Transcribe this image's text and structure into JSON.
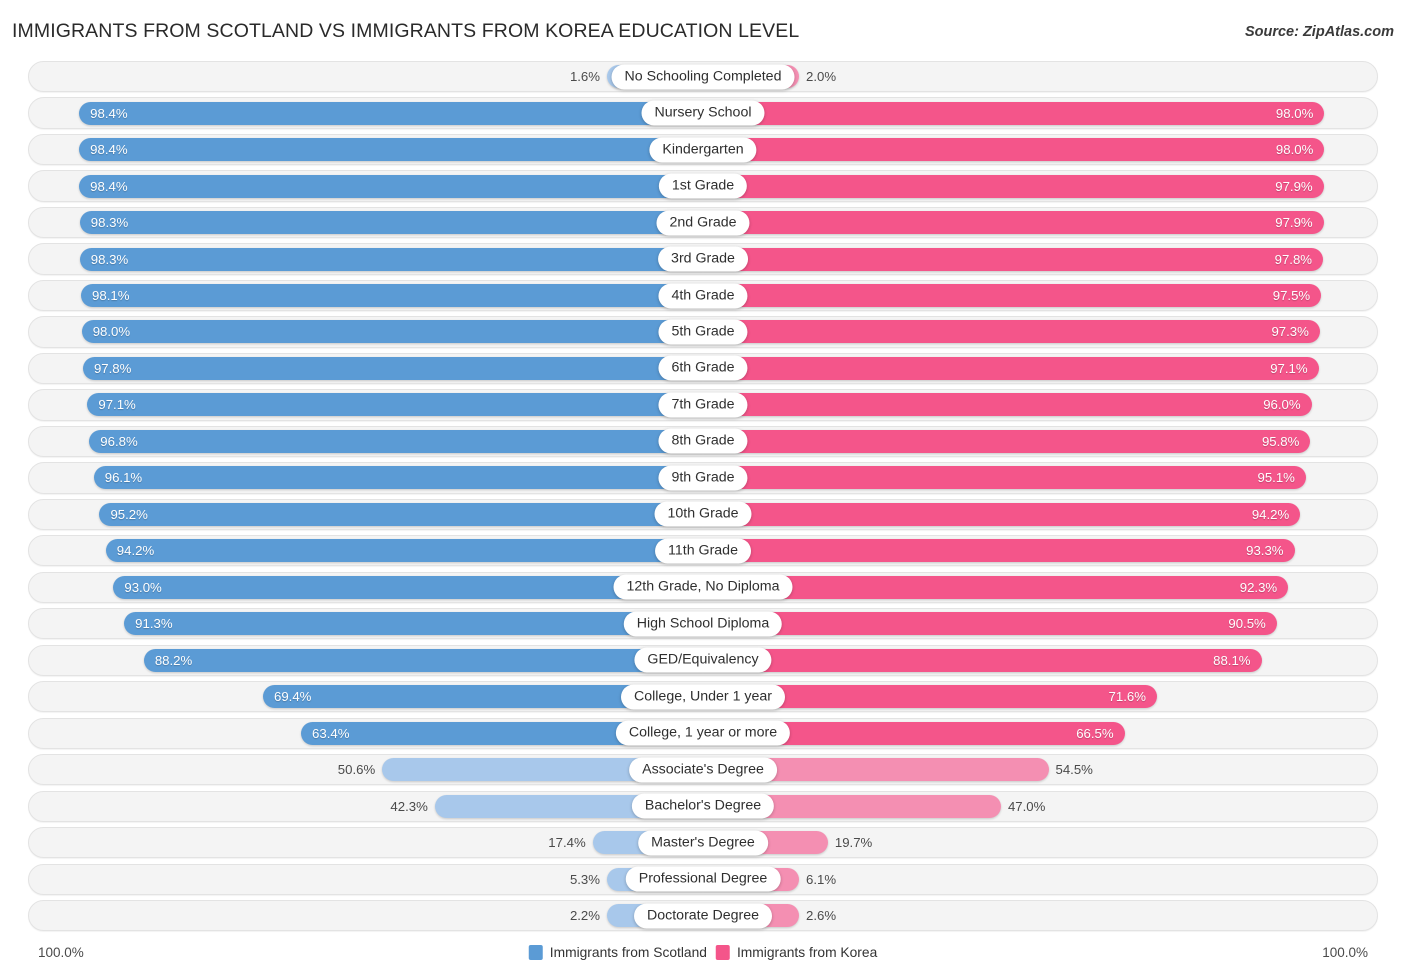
{
  "header": {
    "title": "IMMIGRANTS FROM SCOTLAND VS IMMIGRANTS FROM KOREA EDUCATION LEVEL",
    "source": "Source: ZipAtlas.com"
  },
  "legend": {
    "left": {
      "label": "Immigrants from Scotland",
      "color": "#5b9bd5"
    },
    "right": {
      "label": "Immigrants from Korea",
      "color": "#f4558a"
    }
  },
  "axis": {
    "left_max": "100.0%",
    "right_max": "100.0%"
  },
  "colors": {
    "blue_strong": "#5b9bd5",
    "blue_light": "#a8c8eb",
    "pink_strong": "#f4558a",
    "pink_light": "#f48fb2"
  },
  "chart_data": {
    "type": "bar",
    "orientation": "horizontal-diverging",
    "title": "IMMIGRANTS FROM SCOTLAND VS IMMIGRANTS FROM KOREA EDUCATION LEVEL",
    "xlabel": "",
    "ylabel": "",
    "xlim": [
      0,
      100
    ],
    "grid": false,
    "legend_position": "bottom-center",
    "categories": [
      "No Schooling Completed",
      "Nursery School",
      "Kindergarten",
      "1st Grade",
      "2nd Grade",
      "3rd Grade",
      "4th Grade",
      "5th Grade",
      "6th Grade",
      "7th Grade",
      "8th Grade",
      "9th Grade",
      "10th Grade",
      "11th Grade",
      "12th Grade, No Diploma",
      "High School Diploma",
      "GED/Equivalency",
      "College, Under 1 year",
      "College, 1 year or more",
      "Associate's Degree",
      "Bachelor's Degree",
      "Master's Degree",
      "Professional Degree",
      "Doctorate Degree"
    ],
    "series": [
      {
        "name": "Immigrants from Scotland",
        "color": "#5b9bd5",
        "values": [
          1.6,
          98.4,
          98.4,
          98.4,
          98.3,
          98.3,
          98.1,
          98.0,
          97.8,
          97.1,
          96.8,
          96.1,
          95.2,
          94.2,
          93.0,
          91.3,
          88.2,
          69.4,
          63.4,
          50.6,
          42.3,
          17.4,
          5.3,
          2.2
        ]
      },
      {
        "name": "Immigrants from Korea",
        "color": "#f4558a",
        "values": [
          2.0,
          98.0,
          98.0,
          97.9,
          97.9,
          97.8,
          97.5,
          97.3,
          97.1,
          96.0,
          95.8,
          95.1,
          94.2,
          93.3,
          92.3,
          90.5,
          88.1,
          71.6,
          66.5,
          54.5,
          47.0,
          19.7,
          6.1,
          2.6
        ]
      }
    ]
  },
  "rows": [
    {
      "label": "No Schooling Completed",
      "left": "1.6%",
      "right": "2.0%",
      "lv": 1.6,
      "rv": 2.0,
      "li": false,
      "ri": false
    },
    {
      "label": "Nursery School",
      "left": "98.4%",
      "right": "98.0%",
      "lv": 98.4,
      "rv": 98.0,
      "li": true,
      "ri": true
    },
    {
      "label": "Kindergarten",
      "left": "98.4%",
      "right": "98.0%",
      "lv": 98.4,
      "rv": 98.0,
      "li": true,
      "ri": true
    },
    {
      "label": "1st Grade",
      "left": "98.4%",
      "right": "97.9%",
      "lv": 98.4,
      "rv": 97.9,
      "li": true,
      "ri": true
    },
    {
      "label": "2nd Grade",
      "left": "98.3%",
      "right": "97.9%",
      "lv": 98.3,
      "rv": 97.9,
      "li": true,
      "ri": true
    },
    {
      "label": "3rd Grade",
      "left": "98.3%",
      "right": "97.8%",
      "lv": 98.3,
      "rv": 97.8,
      "li": true,
      "ri": true
    },
    {
      "label": "4th Grade",
      "left": "98.1%",
      "right": "97.5%",
      "lv": 98.1,
      "rv": 97.5,
      "li": true,
      "ri": true
    },
    {
      "label": "5th Grade",
      "left": "98.0%",
      "right": "97.3%",
      "lv": 98.0,
      "rv": 97.3,
      "li": true,
      "ri": true
    },
    {
      "label": "6th Grade",
      "left": "97.8%",
      "right": "97.1%",
      "lv": 97.8,
      "rv": 97.1,
      "li": true,
      "ri": true
    },
    {
      "label": "7th Grade",
      "left": "97.1%",
      "right": "96.0%",
      "lv": 97.1,
      "rv": 96.0,
      "li": true,
      "ri": true
    },
    {
      "label": "8th Grade",
      "left": "96.8%",
      "right": "95.8%",
      "lv": 96.8,
      "rv": 95.8,
      "li": true,
      "ri": true
    },
    {
      "label": "9th Grade",
      "left": "96.1%",
      "right": "95.1%",
      "lv": 96.1,
      "rv": 95.1,
      "li": true,
      "ri": true
    },
    {
      "label": "10th Grade",
      "left": "95.2%",
      "right": "94.2%",
      "lv": 95.2,
      "rv": 94.2,
      "li": true,
      "ri": true
    },
    {
      "label": "11th Grade",
      "left": "94.2%",
      "right": "93.3%",
      "lv": 94.2,
      "rv": 93.3,
      "li": true,
      "ri": true
    },
    {
      "label": "12th Grade, No Diploma",
      "left": "93.0%",
      "right": "92.3%",
      "lv": 93.0,
      "rv": 92.3,
      "li": true,
      "ri": true
    },
    {
      "label": "High School Diploma",
      "left": "91.3%",
      "right": "90.5%",
      "lv": 91.3,
      "rv": 90.5,
      "li": true,
      "ri": true
    },
    {
      "label": "GED/Equivalency",
      "left": "88.2%",
      "right": "88.1%",
      "lv": 88.2,
      "rv": 88.1,
      "li": true,
      "ri": true
    },
    {
      "label": "College, Under 1 year",
      "left": "69.4%",
      "right": "71.6%",
      "lv": 69.4,
      "rv": 71.6,
      "li": true,
      "ri": true
    },
    {
      "label": "College, 1 year or more",
      "left": "63.4%",
      "right": "66.5%",
      "lv": 63.4,
      "rv": 66.5,
      "li": true,
      "ri": true
    },
    {
      "label": "Associate's Degree",
      "left": "50.6%",
      "right": "54.5%",
      "lv": 50.6,
      "rv": 54.5,
      "li": false,
      "ri": false
    },
    {
      "label": "Bachelor's Degree",
      "left": "42.3%",
      "right": "47.0%",
      "lv": 42.3,
      "rv": 47.0,
      "li": false,
      "ri": false
    },
    {
      "label": "Master's Degree",
      "left": "17.4%",
      "right": "19.7%",
      "lv": 17.4,
      "rv": 19.7,
      "li": false,
      "ri": false
    },
    {
      "label": "Professional Degree",
      "left": "5.3%",
      "right": "6.1%",
      "lv": 5.3,
      "rv": 6.1,
      "li": false,
      "ri": false
    },
    {
      "label": "Doctorate Degree",
      "left": "2.2%",
      "right": "2.6%",
      "lv": 2.2,
      "rv": 2.6,
      "li": false,
      "ri": false
    }
  ]
}
